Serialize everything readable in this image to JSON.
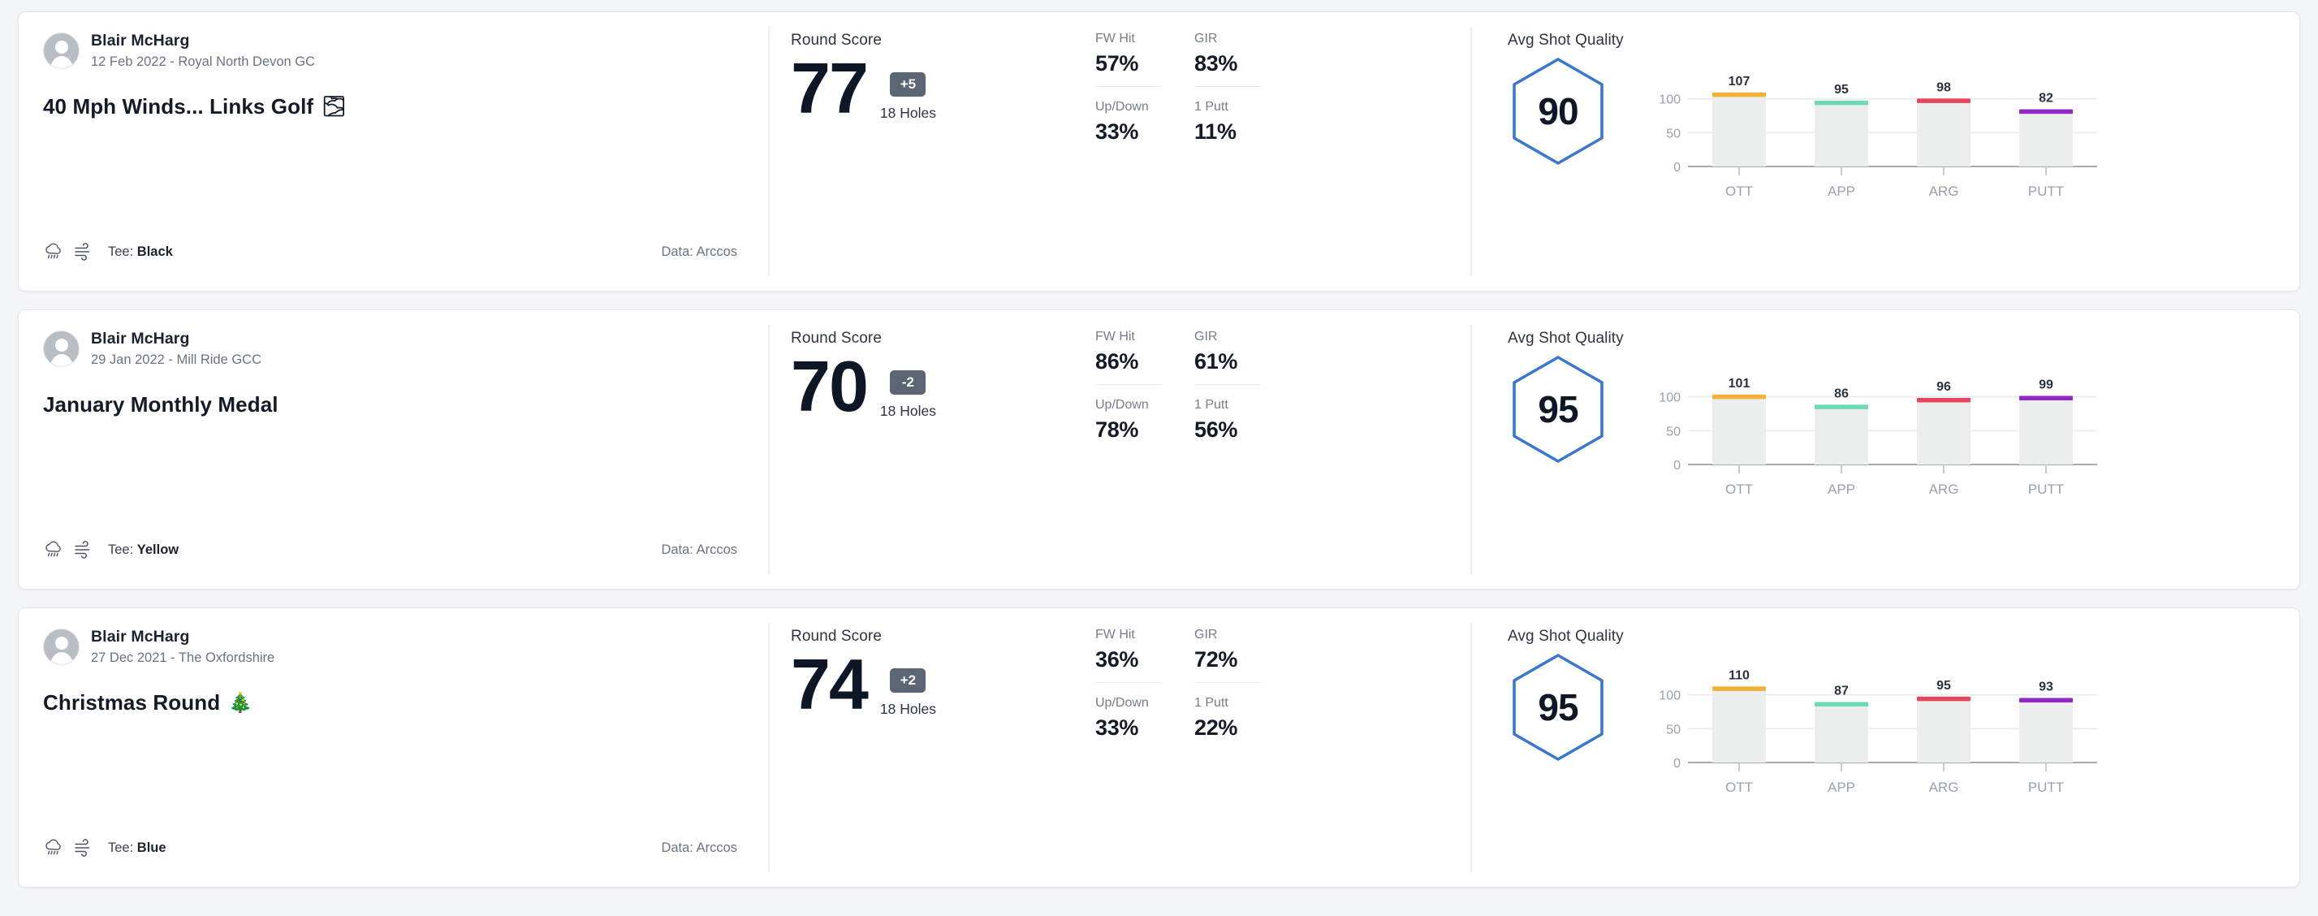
{
  "theme": {
    "page_bg": "#f4f5f7",
    "card_bg": "#ffffff",
    "hex_stroke": "#3b77cc",
    "to_par_bg": "#5b6573",
    "bar_bg": "#eceded",
    "series_colors": {
      "OTT": "#f2b134",
      "APP": "#6fd9b6",
      "ARG": "#e8455f",
      "PUTT": "#9326c9"
    }
  },
  "labels": {
    "round_score": "Round Score",
    "avg_shot_quality": "Avg Shot Quality",
    "holes": "18 Holes",
    "tee_prefix": "Tee: ",
    "data_prefix": "Data: ",
    "fw_hit": "FW Hit",
    "gir": "GIR",
    "up_down": "Up/Down",
    "one_putt": "1 Putt"
  },
  "rounds": [
    {
      "user": "Blair McHarg",
      "date_course": "12 Feb 2022 - Royal North Devon GC",
      "title": "40 Mph Winds... Links Golf",
      "title_emoji": "🌫",
      "tee": "Black",
      "data_source": "Arccos",
      "weather_icons": [
        "rain-cloud-icon",
        "wind-icon"
      ],
      "score": "77",
      "to_par": "+5",
      "holes": "18 Holes",
      "stats": {
        "fw_hit": "57%",
        "gir": "83%",
        "up_down": "33%",
        "one_putt": "11%"
      },
      "avg_shot_quality": "90",
      "chart_data": {
        "type": "bar",
        "title": "Avg Shot Quality",
        "categories": [
          "OTT",
          "APP",
          "ARG",
          "PUTT"
        ],
        "values": [
          107,
          95,
          98,
          82
        ],
        "colors": [
          "#f2b134",
          "#6fd9b6",
          "#e8455f",
          "#9326c9"
        ],
        "yticks": [
          0,
          50,
          100
        ],
        "ylim": [
          0,
          120
        ],
        "xlabel": "",
        "ylabel": "",
        "grid": true,
        "legend": "none"
      }
    },
    {
      "user": "Blair McHarg",
      "date_course": "29 Jan 2022 - Mill Ride GCC",
      "title": "January Monthly Medal",
      "title_emoji": "",
      "tee": "Yellow",
      "data_source": "Arccos",
      "weather_icons": [
        "rain-cloud-icon",
        "wind-icon"
      ],
      "score": "70",
      "to_par": "-2",
      "holes": "18 Holes",
      "stats": {
        "fw_hit": "86%",
        "gir": "61%",
        "up_down": "78%",
        "one_putt": "56%"
      },
      "avg_shot_quality": "95",
      "chart_data": {
        "type": "bar",
        "title": "Avg Shot Quality",
        "categories": [
          "OTT",
          "APP",
          "ARG",
          "PUTT"
        ],
        "values": [
          101,
          86,
          96,
          99
        ],
        "colors": [
          "#f2b134",
          "#6fd9b6",
          "#e8455f",
          "#9326c9"
        ],
        "yticks": [
          0,
          50,
          100
        ],
        "ylim": [
          0,
          120
        ],
        "xlabel": "",
        "ylabel": "",
        "grid": true,
        "legend": "none"
      }
    },
    {
      "user": "Blair McHarg",
      "date_course": "27 Dec 2021 - The Oxfordshire",
      "title": "Christmas Round",
      "title_emoji": "🎄",
      "tee": "Blue",
      "data_source": "Arccos",
      "weather_icons": [
        "rain-cloud-icon",
        "wind-icon"
      ],
      "score": "74",
      "to_par": "+2",
      "holes": "18 Holes",
      "stats": {
        "fw_hit": "36%",
        "gir": "72%",
        "up_down": "33%",
        "one_putt": "22%"
      },
      "avg_shot_quality": "95",
      "chart_data": {
        "type": "bar",
        "title": "Avg Shot Quality",
        "categories": [
          "OTT",
          "APP",
          "ARG",
          "PUTT"
        ],
        "values": [
          110,
          87,
          95,
          93
        ],
        "colors": [
          "#f2b134",
          "#6fd9b6",
          "#e8455f",
          "#9326c9"
        ],
        "yticks": [
          0,
          50,
          100
        ],
        "ylim": [
          0,
          120
        ],
        "xlabel": "",
        "ylabel": "",
        "grid": true,
        "legend": "none"
      }
    }
  ]
}
